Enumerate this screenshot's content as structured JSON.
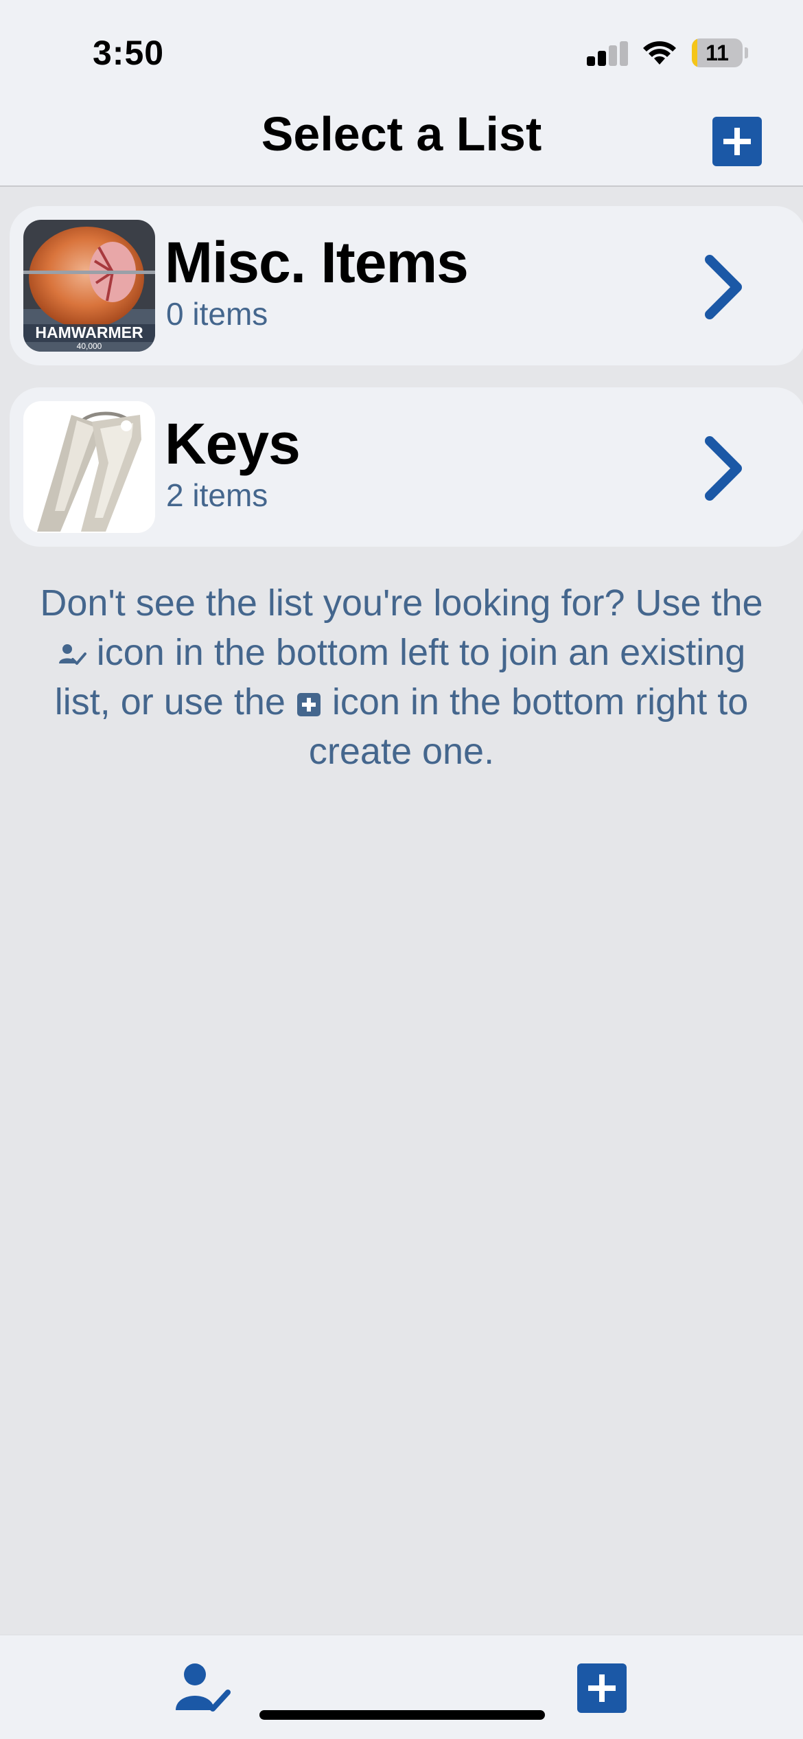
{
  "status_bar": {
    "time": "3:50",
    "battery": "11",
    "battery_level": 0.11
  },
  "header": {
    "title": "Select a List"
  },
  "lists": [
    {
      "name": "Misc. Items",
      "count": "0 items",
      "thumbnail_text": "HAMWARMER",
      "thumbnail_subtext": "40,000"
    },
    {
      "name": "Keys",
      "count": "2 items"
    }
  ],
  "hint": {
    "part1": "Don't see the list you're looking for? Use the",
    "part2": "icon in the bottom left to join an existing list, or use the",
    "part3": "icon in the bottom right to create one."
  },
  "icons": {
    "add": "plus-square-icon",
    "join": "person-check-icon",
    "chevron": "chevron-right-icon",
    "signal": "cellular-signal-icon",
    "wifi": "wifi-icon",
    "battery": "battery-icon"
  },
  "colors": {
    "accent": "#1b58a6",
    "secondary_text": "#44668d",
    "background": "#e5e6e9",
    "surface": "#eff1f5"
  }
}
